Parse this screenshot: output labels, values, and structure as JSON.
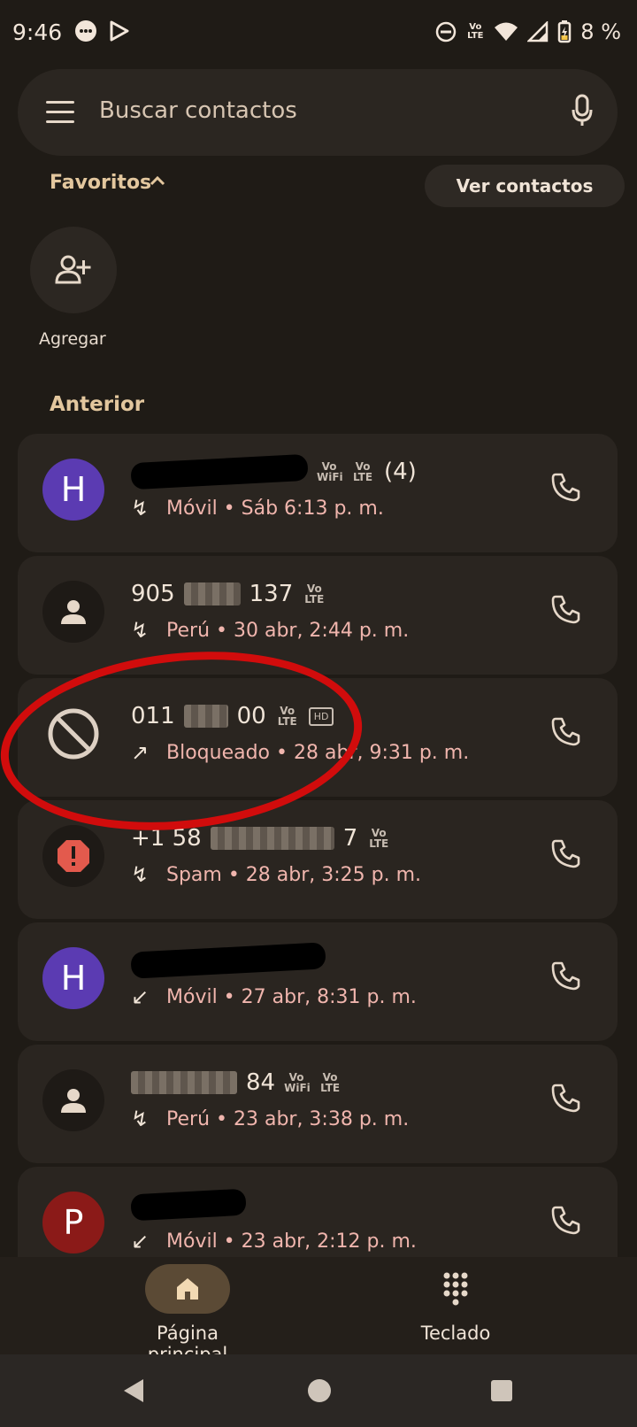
{
  "status_bar": {
    "time": "9:46",
    "volte_label": "Vo LTE",
    "battery_percent": "8 %"
  },
  "search": {
    "placeholder": "Buscar contactos"
  },
  "favorites": {
    "title": "Favoritos",
    "view_contacts": "Ver contactos",
    "add_label": "Agregar"
  },
  "recent": {
    "section_title": "Anterior",
    "calls": [
      {
        "avatar": "H",
        "avatar_color": "#5b3bb2",
        "name_suffix": "(4)",
        "badges": [
          "Vo WiFi",
          "Vo LTE"
        ],
        "detail": "Móvil • Sáb 6:13 p. m.",
        "direction": "missed"
      },
      {
        "avatar": "person",
        "avatar_color": "#2c2722",
        "name": "905",
        "name_end": "137",
        "badges": [
          "Vo LTE"
        ],
        "detail": "Perú • 30 abr, 2:44 p. m.",
        "direction": "missed"
      },
      {
        "avatar": "blocked",
        "avatar_color": "transparent",
        "name": "011",
        "name_end": "00",
        "badges": [
          "Vo LTE",
          "HD"
        ],
        "detail": "Bloqueado • 28 abr, 9:31 p. m.",
        "direction": "outgoing"
      },
      {
        "avatar": "spam",
        "avatar_color": "#2c2722",
        "name": "+1 58",
        "name_end": "7",
        "badges": [
          "Vo LTE"
        ],
        "detail": "Spam • 28 abr, 3:25 p. m.",
        "direction": "missed"
      },
      {
        "avatar": "H",
        "avatar_color": "#5b3bb2",
        "badges": [],
        "detail": "Móvil • 27 abr, 8:31 p. m.",
        "direction": "incoming"
      },
      {
        "avatar": "person",
        "avatar_color": "#2c2722",
        "name_end": "84",
        "badges": [
          "Vo WiFi",
          "Vo LTE"
        ],
        "detail": "Perú • 23 abr, 3:38 p. m.",
        "direction": "missed"
      },
      {
        "avatar": "P",
        "avatar_color": "#8b1a18",
        "badges": [],
        "detail": "Móvil • 23 abr, 2:12 p. m.",
        "direction": "incoming"
      }
    ]
  },
  "bottom_nav": {
    "home": "Página principal",
    "keypad": "Teclado"
  },
  "colors": {
    "background": "#1f1b16",
    "card": "#2a2520",
    "accent": "#e3c79e",
    "detail_text": "#f0b5ad",
    "highlight_circle": "#d10c0c"
  }
}
